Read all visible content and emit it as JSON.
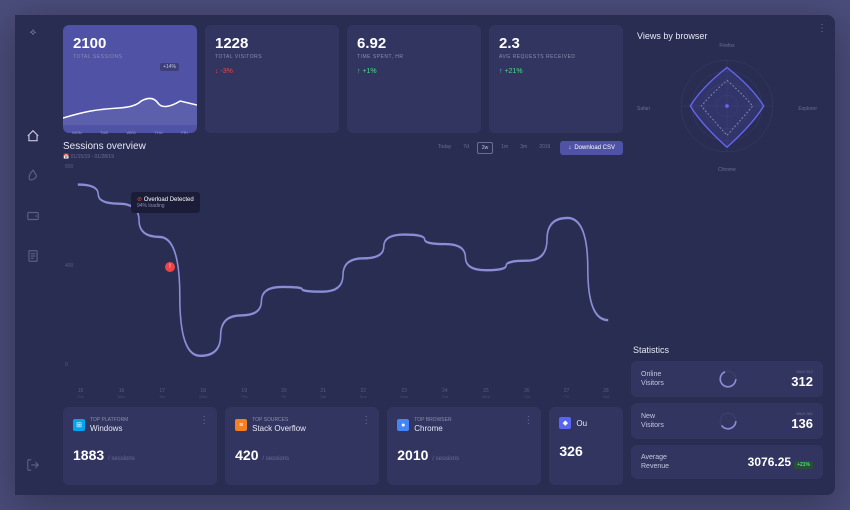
{
  "stats": {
    "sessions": {
      "value": "2100",
      "label": "TOTAL SESSIONS",
      "badge": "+14%"
    },
    "visitors": {
      "value": "1228",
      "label": "TOTAL VISITORS",
      "delta": "↓ -3%",
      "dir": "down"
    },
    "time": {
      "value": "6.92",
      "label": "TIME SPENT, HR",
      "delta": "↑ +1%",
      "dir": "up"
    },
    "requests": {
      "value": "2.3",
      "label": "AVG REQUESTS RECEIVED",
      "delta": "↑ +21%",
      "dir": "up"
    }
  },
  "overview": {
    "title": "Sessions overview",
    "date": "01/15/19 - 01/28/19",
    "ranges": [
      "Today",
      "7d",
      "2w",
      "1m",
      "3m",
      "2019"
    ],
    "active_range": "2w",
    "download": "Download CSV",
    "tooltip": {
      "title": "Overload Detected",
      "sub": "94% loading"
    },
    "y": [
      "800",
      "400",
      "0"
    ]
  },
  "chart_data": {
    "type": "line",
    "categories": [
      "15",
      "16",
      "17",
      "18",
      "19",
      "20",
      "21",
      "22",
      "23",
      "24",
      "25",
      "26",
      "27",
      "28"
    ],
    "days": [
      "Sun",
      "Mon",
      "Tue",
      "Wed",
      "Thu",
      "Fri",
      "Sat",
      "Sun",
      "Mon",
      "Tue",
      "Wed",
      "Thu",
      "Fri",
      "Sat"
    ],
    "values": [
      780,
      700,
      560,
      60,
      230,
      350,
      330,
      470,
      570,
      530,
      420,
      460,
      640,
      210
    ],
    "ylim": [
      0,
      800
    ],
    "xlabel": "",
    "ylabel": ""
  },
  "bottom": [
    {
      "key": "platform",
      "label": "TOP PLATFORM",
      "name": "Windows",
      "value": "1883",
      "unit": "/ sessions",
      "icon": "⊞",
      "iconbg": "#00a4ef"
    },
    {
      "key": "sources",
      "label": "TOP SOURCES",
      "name": "Stack Overflow",
      "value": "420",
      "unit": "/ sessions",
      "icon": "≡",
      "iconbg": "#f48024"
    },
    {
      "key": "browser",
      "label": "TOP BROWSER",
      "name": "Chrome",
      "value": "2010",
      "unit": "/ sessions",
      "icon": "●",
      "iconbg": "#4285f4"
    },
    {
      "key": "partial",
      "label": "",
      "name": "Ou",
      "value": "326",
      "unit": "",
      "icon": "◆",
      "iconbg": "#5865f2"
    }
  ],
  "radar": {
    "title": "Views by browser",
    "labels": {
      "top": "Firefox",
      "right": "Explorer",
      "bottom": "Chrome",
      "left": "Safari"
    }
  },
  "statistics": {
    "title": "Statistics",
    "items": [
      {
        "label": "Online Visitors",
        "max": "MAX 512",
        "value": "312"
      },
      {
        "label": "New Visitors",
        "max": "MAX 381",
        "value": "136"
      },
      {
        "label": "Average Revenue",
        "value": "3076.25",
        "badge": "+21%"
      }
    ]
  },
  "mini_chart_days": [
    "MON",
    "TUE",
    "WED",
    "THU",
    "FRI"
  ]
}
